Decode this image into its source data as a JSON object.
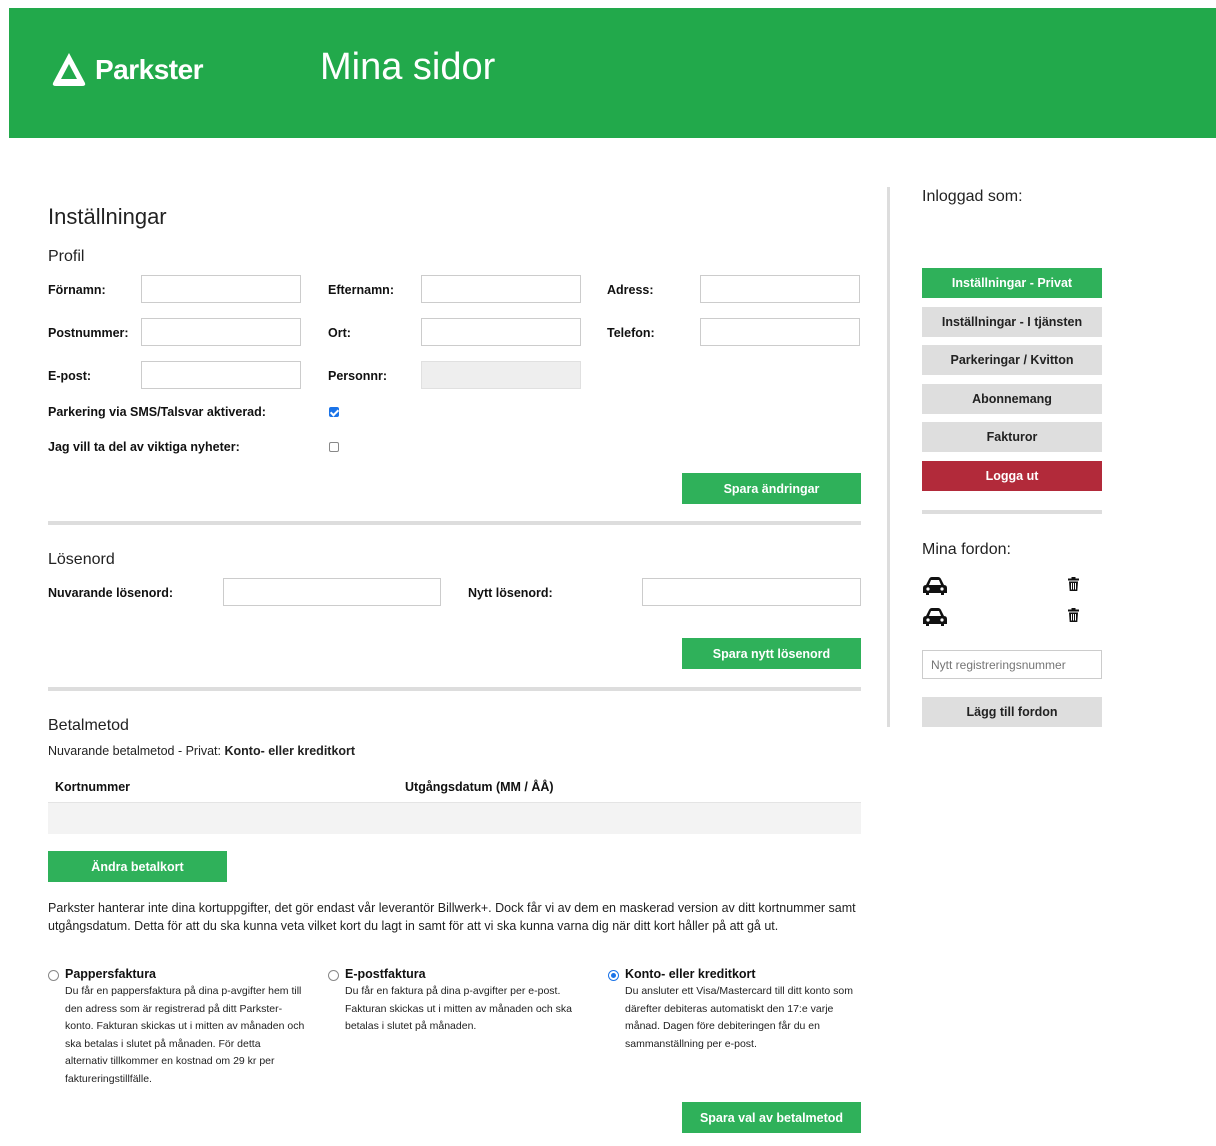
{
  "header": {
    "brand": "Parkster",
    "title": "Mina sidor"
  },
  "settings": {
    "title": "Inställningar",
    "profile": {
      "title": "Profil",
      "firstname_label": "Förnamn:",
      "lastname_label": "Efternamn:",
      "address_label": "Adress:",
      "postal_label": "Postnummer:",
      "city_label": "Ort:",
      "phone_label": "Telefon:",
      "email_label": "E-post:",
      "personnr_label": "Personnr:",
      "sms_label": "Parkering via SMS/Talsvar aktiverad:",
      "sms_checked": true,
      "news_label": "Jag vill ta del av viktiga nyheter:",
      "news_checked": false,
      "save_button": "Spara ändringar"
    },
    "password": {
      "title": "Lösenord",
      "current_label": "Nuvarande lösenord:",
      "new_label": "Nytt lösenord:",
      "save_button": "Spara nytt lösenord"
    },
    "payment": {
      "title": "Betalmetod",
      "current_prefix": "Nuvarande betalmetod - Privat:",
      "current_value": "Konto- eller kreditkort",
      "table_headers": [
        "Kortnummer",
        "Utgångsdatum (MM / ÅÅ)"
      ],
      "change_button": "Ändra betalkort",
      "note": "Parkster hanterar inte dina kortuppgifter, det gör endast vår leverantör Billwerk+. Dock får vi av dem en maskerad version av ditt kortnummer samt utgångsdatum. Detta för att du ska kunna veta vilket kort du lagt in samt för att vi ska kunna varna dig när ditt kort håller på att gå ut.",
      "options": [
        {
          "title": "Pappersfaktura",
          "description": "Du får en pappersfaktura på dina p-avgifter hem till den adress som är registrerad på ditt Parkster-konto. Fakturan skickas ut i mitten av månaden och ska betalas i slutet på månaden. För detta alternativ tillkommer en kostnad om 29 kr per faktureringstillfälle.",
          "selected": false
        },
        {
          "title": "E-postfaktura",
          "description": "Du får en faktura på dina p-avgifter per e-post. Fakturan skickas ut i mitten av månaden och ska betalas i slutet på månaden.",
          "selected": false
        },
        {
          "title": "Konto- eller kreditkort",
          "description": "Du ansluter ett Visa/Mastercard till ditt konto som därefter debiteras automatiskt den 17:e varje månad. Dagen före debiteringen får du en sammanställning per e-post.",
          "selected": true
        }
      ],
      "save_button": "Spara val av betalmetod"
    }
  },
  "sidebar": {
    "logged_in_label": "Inloggad som:",
    "menu": [
      {
        "label": "Inställningar - Privat",
        "style": "green"
      },
      {
        "label": "Inställningar - I tjänsten",
        "style": "gray"
      },
      {
        "label": "Parkeringar / Kvitton",
        "style": "gray"
      },
      {
        "label": "Abonnemang",
        "style": "gray"
      },
      {
        "label": "Fakturor",
        "style": "gray"
      },
      {
        "label": "Logga ut",
        "style": "red"
      }
    ],
    "vehicles_title": "Mina fordon:",
    "new_reg_placeholder": "Nytt registreringsnummer",
    "add_vehicle_button": "Lägg till fordon"
  },
  "colors": {
    "brand_green": "#22a94b",
    "button_green": "#2fb15a",
    "logout_red": "#b22a3a",
    "button_gray": "#dedede"
  },
  "icons": [
    "parkster-logo-icon",
    "car-icon",
    "trash-icon",
    "checkbox",
    "radio"
  ]
}
